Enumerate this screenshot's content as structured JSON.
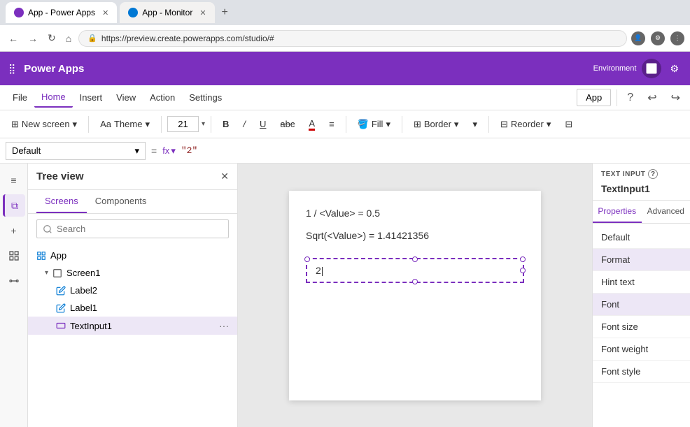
{
  "browser": {
    "tabs": [
      {
        "id": "tab1",
        "label": "App - Power Apps",
        "icon_color": "#7b2fbe",
        "active": true
      },
      {
        "id": "tab2",
        "label": "App - Monitor",
        "icon_color": "#0078d4",
        "active": false
      }
    ],
    "address": "https://preview.create.powerapps.com/studio/#",
    "new_tab_icon": "+"
  },
  "app_header": {
    "logo": "Power Apps",
    "env_label": "Environment",
    "settings_icon": "⚙"
  },
  "menu": {
    "items": [
      "File",
      "Home",
      "Insert",
      "View",
      "Action",
      "Settings"
    ],
    "active_item": "Home",
    "right": {
      "app_label": "App",
      "undo_icon": "↩",
      "redo_icon": "↪"
    }
  },
  "toolbar": {
    "new_screen_label": "New screen",
    "theme_label": "Theme",
    "font_size": "21",
    "bold_label": "B",
    "italic_label": "/",
    "underline_label": "U",
    "strikethrough_label": "abc",
    "font_color_label": "A",
    "align_label": "≡",
    "fill_label": "Fill",
    "border_label": "Border",
    "dropdown_icon": "▾",
    "reorder_label": "Reorder",
    "align_right_label": "⊟"
  },
  "formula_bar": {
    "property": "Default",
    "equals": "=",
    "fx_label": "fx",
    "value": "\"2\""
  },
  "tree_panel": {
    "title": "Tree view",
    "tabs": [
      "Screens",
      "Components"
    ],
    "active_tab": "Screens",
    "search_placeholder": "Search",
    "close_icon": "✕",
    "items": [
      {
        "id": "app",
        "label": "App",
        "icon": "⊞",
        "indent": 0,
        "type": "app"
      },
      {
        "id": "screen1",
        "label": "Screen1",
        "icon": "□",
        "indent": 1,
        "type": "screen",
        "expanded": true
      },
      {
        "id": "label2",
        "label": "Label2",
        "icon": "✎",
        "indent": 2,
        "type": "label"
      },
      {
        "id": "label1",
        "label": "Label1",
        "icon": "✎",
        "indent": 2,
        "type": "label"
      },
      {
        "id": "textinput1",
        "label": "TextInput1",
        "icon": "⊟",
        "indent": 2,
        "type": "input",
        "selected": true,
        "more_icon": "···"
      }
    ]
  },
  "canvas": {
    "line1": "1 / <Value> = 0.5",
    "line2": "Sqrt(<Value>) = 1.41421356",
    "text_input_value": "2"
  },
  "right_panel": {
    "component_type": "TEXT INPUT",
    "help_icon": "?",
    "component_name": "TextInput1",
    "tabs": [
      "Properties",
      "Advanced"
    ],
    "active_tab": "Properties",
    "props": [
      {
        "id": "default",
        "label": "Default"
      },
      {
        "id": "format",
        "label": "Format"
      },
      {
        "id": "hint_text",
        "label": "Hint text"
      },
      {
        "id": "font",
        "label": "Font"
      },
      {
        "id": "font_size",
        "label": "Font size"
      },
      {
        "id": "font_weight",
        "label": "Font weight"
      },
      {
        "id": "font_style",
        "label": "Font style"
      }
    ]
  },
  "left_sidebar": {
    "icons": [
      {
        "id": "back",
        "symbol": "≡",
        "tooltip": "Back"
      },
      {
        "id": "layers",
        "symbol": "⧉",
        "tooltip": "Tree view",
        "active": true
      },
      {
        "id": "add",
        "symbol": "+",
        "tooltip": "Insert"
      },
      {
        "id": "data",
        "symbol": "⊞",
        "tooltip": "Data"
      },
      {
        "id": "connect",
        "symbol": "⊡",
        "tooltip": "Connections"
      }
    ]
  }
}
